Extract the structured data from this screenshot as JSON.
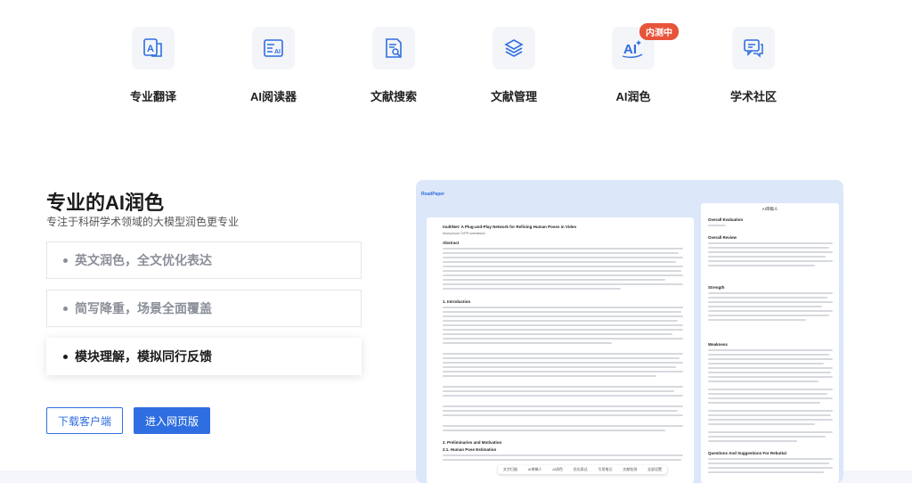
{
  "features": [
    {
      "label": "专业翻译",
      "icon": "translate-icon"
    },
    {
      "label": "AI阅读器",
      "icon": "ai-reader-icon"
    },
    {
      "label": "文献搜索",
      "icon": "doc-search-icon"
    },
    {
      "label": "文献管理",
      "icon": "layers-icon"
    },
    {
      "label": "AI润色",
      "icon": "ai-polish-icon",
      "badge": "内测中"
    },
    {
      "label": "学术社区",
      "icon": "chat-icon"
    }
  ],
  "hero": {
    "title": "专业的AI润色",
    "subtitle": "专注于科研学术领域的大模型润色更专业",
    "cards": [
      "英文润色，全文优化表达",
      "简写降重，场景全面覆盖",
      "模块理解，模拟同行反馈"
    ],
    "download_label": "下载客户端",
    "web_label": "进入网页版"
  },
  "preview": {
    "app_name": "ReadPaper",
    "doc_title": "multiNet: A Plug-and-Play Network for Refining Human Poses in Video",
    "doc_subtitle": "Anonymous CVPR submission",
    "sections": [
      "Abstract",
      "1. Introduction",
      "2. Preliminaries and Motivation",
      "2.1. Human Pose Estimation"
    ],
    "side_title": "AI审稿人",
    "side_sections": [
      "Overall Evaluation",
      "Overall Review",
      "Strength",
      "Weakness",
      "Questions And Suggestions For Rebuttal"
    ],
    "float_toolbar": [
      "文字扫描",
      "AI审稿人",
      "AI润色",
      "优化表达",
      "引用笔记",
      "文献检测",
      "全部设置"
    ]
  },
  "colors": {
    "accent": "#2f6ee0",
    "badge": "#e8543a"
  }
}
